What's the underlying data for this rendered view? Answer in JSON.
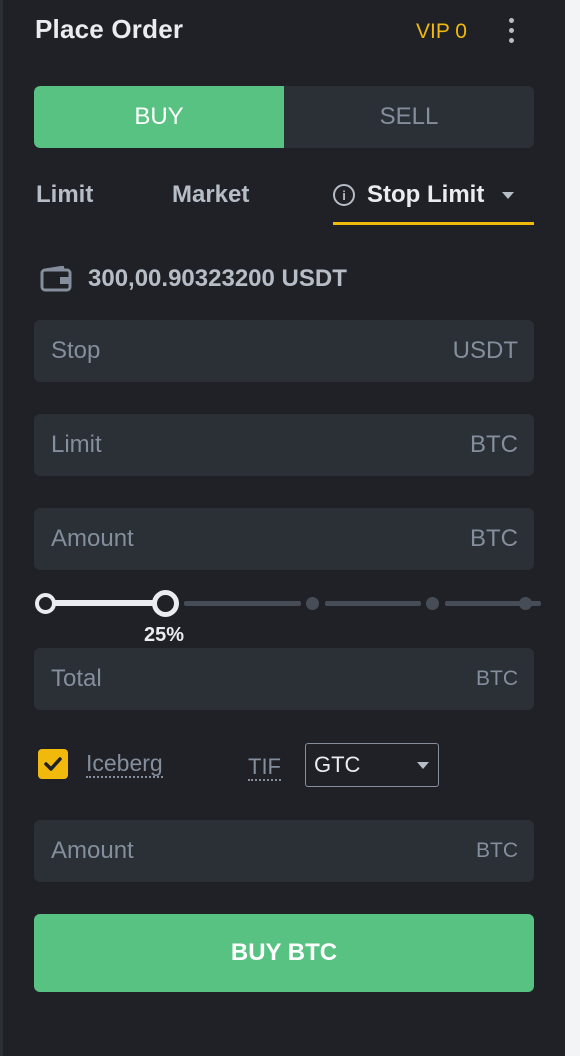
{
  "header": {
    "title": "Place Order",
    "vip": "VIP 0"
  },
  "side_toggle": {
    "buy": "BUY",
    "sell": "SELL"
  },
  "order_tabs": {
    "limit": "Limit",
    "market": "Market",
    "stop_limit": "Stop Limit",
    "info_glyph": "i"
  },
  "balance": {
    "value": "300,00.90323200 USDT",
    "icon": "wallet-icon"
  },
  "fields": {
    "stop": {
      "label": "Stop",
      "unit": "USDT"
    },
    "limit": {
      "label": "Limit",
      "unit": "BTC"
    },
    "amount": {
      "label": "Amount",
      "unit": "BTC"
    },
    "total": {
      "label": "Total",
      "unit": "BTC"
    },
    "iceberg_amount": {
      "label": "Amount",
      "unit": "BTC"
    }
  },
  "slider": {
    "percent_label": "25%",
    "value": 0.25
  },
  "options": {
    "iceberg_label": "Iceberg",
    "iceberg_checked": true,
    "tif_label": "TIF",
    "tif_value": "GTC"
  },
  "submit": {
    "label": "BUY BTC"
  },
  "colors": {
    "buy": "#58c283",
    "accent": "#f0b90b",
    "panel": "#1f2126",
    "input": "#2b2f36"
  }
}
